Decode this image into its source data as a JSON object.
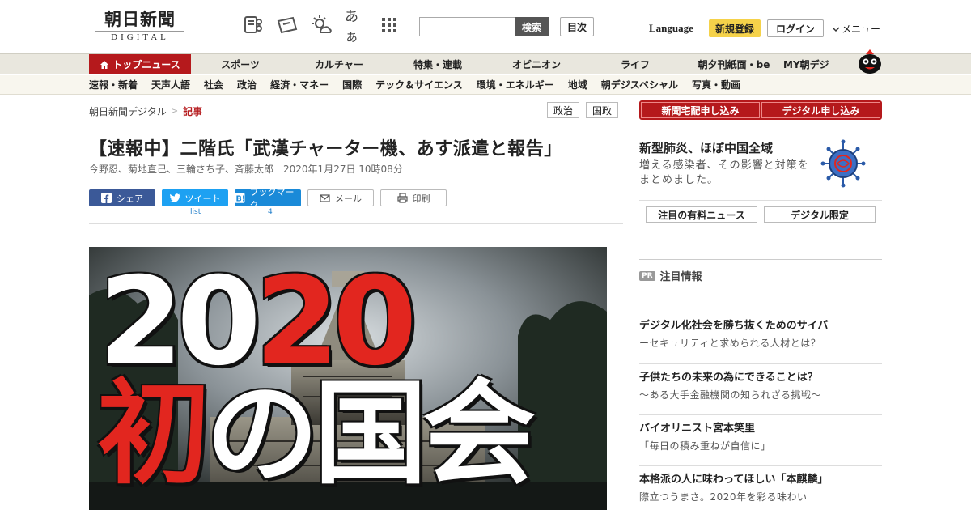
{
  "header": {
    "logo_main": "朝日新聞",
    "logo_sub": "DIGITAL",
    "icon_text_size": "あぁ",
    "search_button": "検索",
    "index_button": "目次",
    "language": "Language",
    "signup": "新規登録",
    "login": "ログイン",
    "menu": "メニュー"
  },
  "main_nav": {
    "items": [
      {
        "label": "トップニュース"
      },
      {
        "label": "スポーツ"
      },
      {
        "label": "カルチャー"
      },
      {
        "label": "特集・連載"
      },
      {
        "label": "オピニオン"
      },
      {
        "label": "ライフ"
      },
      {
        "label": "朝夕刊紙面・be"
      },
      {
        "label": "MY朝デジ"
      }
    ]
  },
  "sub_nav": {
    "items": [
      "速報・新着",
      "天声人語",
      "社会",
      "政治",
      "経済・マネー",
      "国際",
      "テック＆サイエンス",
      "環境・エネルギー",
      "地域",
      "朝デジスペシャル",
      "写真・動画"
    ]
  },
  "breadcrumb": {
    "root": "朝日新聞デジタル",
    "sep": ">",
    "current": "記事"
  },
  "tags": [
    "政治",
    "国政"
  ],
  "article": {
    "title": "【速報中】二階氏「武漢チャーター機、あす派遣と報告」",
    "authors": "今野忍、菊地直己、三輪さち子、斉藤太郎",
    "date": "2020年1月27日 10時08分"
  },
  "share": {
    "facebook": "シェア",
    "twitter": "ツイート",
    "twitter_count": "list",
    "hatena": "ブックマーク",
    "hatena_count": "4",
    "mail": "メール",
    "print": "印刷"
  },
  "hero": {
    "line1_a": "20",
    "line1_b": "20",
    "line2_a": "初",
    "line2_b": "の国会"
  },
  "sidebar": {
    "subscribe_paper": "新聞宅配申し込み",
    "subscribe_digital": "デジタル申し込み",
    "feature_title": "新型肺炎、ほぼ中国全域",
    "feature_desc": "増える感染者、その影響と対策をまとめました。",
    "tab_premium": "注目の有料ニュース",
    "tab_digital": "デジタル限定",
    "pr_badge": "PR",
    "pr_heading": "注目情報",
    "pr_items": [
      {
        "title": "デジタル化社会を勝ち抜くためのサイバ",
        "sub": "ーセキュリティと求められる人材とは？"
      },
      {
        "title": "子供たちの未来の為にできることは？",
        "sub": "～ある大手金融機関の知られざる挑戦～"
      },
      {
        "title": "バイオリニスト宮本笑里",
        "sub": "「毎日の積み重ねが自信に」"
      },
      {
        "title": "本格派の人に味わってほしい「本麒麟」",
        "sub": "際立つうまさ。2020年を彩る味わい"
      }
    ]
  },
  "colors": {
    "brand_red": "#b5191c",
    "hero_red": "#e2261f",
    "signup_yellow": "#f5d24a",
    "facebook": "#3b5998",
    "twitter": "#1da1f2",
    "hatena": "#1a8ad8"
  }
}
